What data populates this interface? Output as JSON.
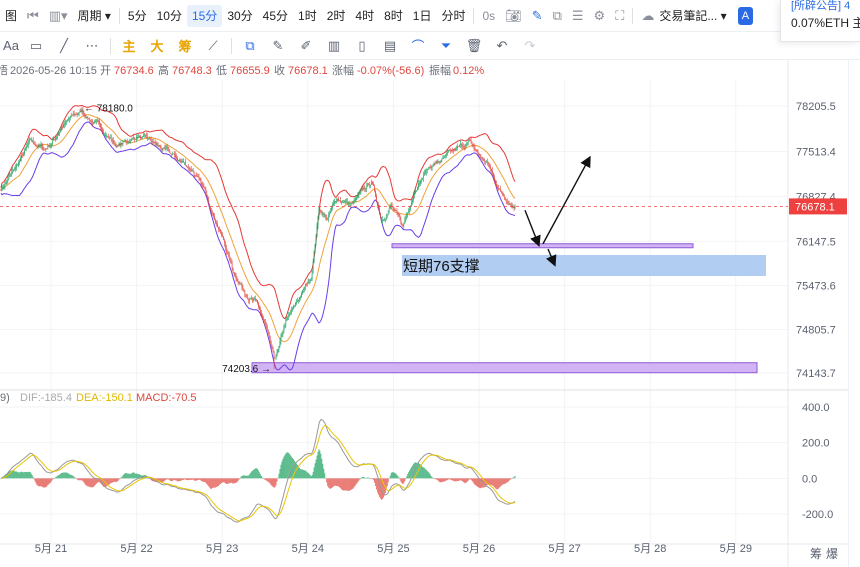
{
  "toolbar": {
    "left_glyph": "图",
    "prev_icon": "skip-back-icon",
    "chart_type_icon": "candles-icon",
    "period_label": "周期",
    "intervals": [
      "5分",
      "10分",
      "15分",
      "30分",
      "45分",
      "1时",
      "2时",
      "4时",
      "8时",
      "1日",
      "分时"
    ],
    "active_interval": "15分",
    "seconds_label": "0s",
    "cloud_label": "交易筆記...",
    "user_badge": "A"
  },
  "drawing_toolbar": {
    "text_tool": "Aa",
    "indicators": [
      "主",
      "大",
      "筹"
    ]
  },
  "popup": {
    "line1": "[所辟公告] 4",
    "line2": "0.07%ETH 主"
  },
  "colors": {
    "up": "#1aa05e",
    "down": "#e0463e",
    "bb_upper": "#e53935",
    "bb_lower": "#6a3de8",
    "ma": "#f0a33a",
    "zone_fill": "#d2b4f5",
    "zone_stroke": "#8e5bd6",
    "label_fill": "#a8c8f0",
    "price_tag": "#ef4040",
    "dif_line": "#999999",
    "dea_line": "#e8c400",
    "accent": "#2a6be5"
  },
  "chart_data": {
    "type": "candlestick",
    "symbol_prefix": "悟",
    "ohlc_header": {
      "datetime": "2026-05-26 10:15",
      "open_label": "开",
      "open": "76734.6",
      "high_label": "高",
      "high": "76748.3",
      "low_label": "低",
      "low": "76655.9",
      "close_label": "收",
      "close": "76678.1",
      "change_label": "涨幅",
      "change": "-0.07%(-56.6)",
      "amp_label": "振幅",
      "amp": "0.12%"
    },
    "price_axis": {
      "ticks": [
        "78205.5",
        "77513.4",
        "76827.4",
        "76147.5",
        "75473.6",
        "74805.7",
        "74143.7"
      ],
      "tick_values": [
        78205.5,
        77513.4,
        76827.4,
        76147.5,
        75473.6,
        74805.7,
        74143.7
      ],
      "range": [
        73900,
        78600
      ]
    },
    "current_price": "76678.1",
    "current_price_value": 76678.1,
    "high_marker": {
      "text": "← 78180.0",
      "value": 78180.0
    },
    "low_marker": {
      "text": "74203.6 →",
      "value": 74203.6
    },
    "support_label": "短期76支撑",
    "support_zone": {
      "price_top": 76110,
      "price_bottom": 76055
    },
    "big_zone": {
      "price_top": 74300,
      "price_bottom": 74180
    },
    "x_labels": [
      "5月 21",
      "5月 22",
      "5月 23",
      "5月 24",
      "5月 25",
      "5月 26",
      "5月 27",
      "5月 28",
      "5月 29"
    ],
    "candle_count": 528,
    "keypoints": [
      {
        "i": 0,
        "p": 76950
      },
      {
        "i": 15,
        "p": 77250
      },
      {
        "i": 30,
        "p": 77650
      },
      {
        "i": 45,
        "p": 77550
      },
      {
        "i": 55,
        "p": 77700
      },
      {
        "i": 62,
        "p": 77900
      },
      {
        "i": 75,
        "p": 78050
      },
      {
        "i": 83,
        "p": 78120
      },
      {
        "i": 100,
        "p": 77900
      },
      {
        "i": 120,
        "p": 77600
      },
      {
        "i": 140,
        "p": 77750
      },
      {
        "i": 160,
        "p": 77600
      },
      {
        "i": 180,
        "p": 77400
      },
      {
        "i": 196,
        "p": 77250
      },
      {
        "i": 212,
        "p": 76800
      },
      {
        "i": 225,
        "p": 76300
      },
      {
        "i": 238,
        "p": 75700
      },
      {
        "i": 250,
        "p": 75400
      },
      {
        "i": 262,
        "p": 75200
      },
      {
        "i": 272,
        "p": 74800
      },
      {
        "i": 280,
        "p": 74300
      },
      {
        "i": 285,
        "p": 74500
      },
      {
        "i": 292,
        "p": 74900
      },
      {
        "i": 300,
        "p": 75100
      },
      {
        "i": 310,
        "p": 75400
      },
      {
        "i": 318,
        "p": 75600
      },
      {
        "i": 326,
        "p": 76650
      },
      {
        "i": 335,
        "p": 76500
      },
      {
        "i": 345,
        "p": 76800
      },
      {
        "i": 360,
        "p": 76700
      },
      {
        "i": 372,
        "p": 76900
      },
      {
        "i": 380,
        "p": 77050
      },
      {
        "i": 390,
        "p": 76500
      },
      {
        "i": 400,
        "p": 76700
      },
      {
        "i": 412,
        "p": 76350
      },
      {
        "i": 425,
        "p": 77000
      },
      {
        "i": 440,
        "p": 77300
      },
      {
        "i": 455,
        "p": 77400
      },
      {
        "i": 470,
        "p": 77550
      },
      {
        "i": 480,
        "p": 77650
      },
      {
        "i": 490,
        "p": 77450
      },
      {
        "i": 500,
        "p": 77300
      },
      {
        "i": 510,
        "p": 76950
      },
      {
        "i": 527,
        "p": 76678
      }
    ],
    "macd": {
      "header": ",9) DIF:-185.4 DEA:-150.1 MACD:-70.5",
      "header_prefix": ",9)",
      "dif_label": "DIF:-185.4",
      "dea_label": "DEA:-150.1",
      "macd_label": "MACD:-70.5",
      "ticks": [
        "400.0",
        "200.0",
        "0.0",
        "-200.0"
      ],
      "tick_values": [
        400,
        200,
        0,
        -200
      ],
      "range": [
        -300,
        420
      ]
    }
  },
  "bottom_right": [
    "筹",
    "爆"
  ]
}
